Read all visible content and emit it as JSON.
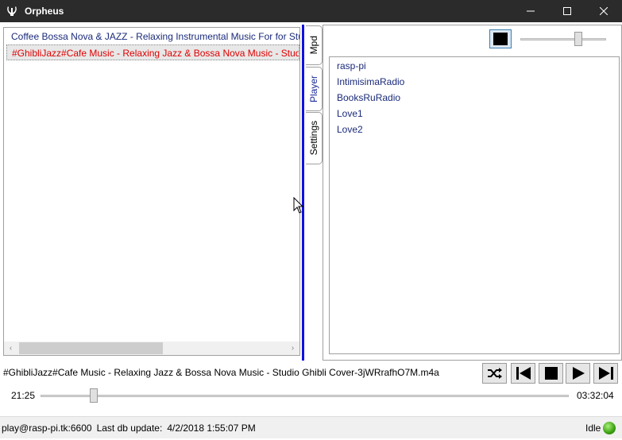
{
  "window": {
    "title": "Orpheus",
    "controls": [
      "minimize",
      "maximize",
      "close"
    ]
  },
  "playlist": {
    "items": [
      {
        "label": "Coffee Bossa Nova & JAZZ - Relaxing Instrumental Music For for Study"
      },
      {
        "label": "#GhibliJazz#Cafe Music - Relaxing Jazz & Bossa Nova Music - Studio Ghibli Cover"
      }
    ],
    "scroll_left": "‹",
    "scroll_right": "›"
  },
  "tabs": [
    {
      "label": "Mpd"
    },
    {
      "label": "Player"
    },
    {
      "label": "Settings"
    }
  ],
  "player": {
    "volume_fraction": 0.68,
    "stations": [
      "rasp-pi",
      "IntimisimaRadio",
      "BooksRuRadio",
      "Love1",
      "Love2"
    ]
  },
  "now_playing": {
    "title": "#GhibliJazz#Cafe Music - Relaxing Jazz & Bossa Nova Music - Studio Ghibli Cover-3jWRrafhO7M.m4a",
    "elapsed": "21:25",
    "total": "03:32:04",
    "progress_fraction": 0.101
  },
  "controls": {
    "icons": [
      "shuffle-icon",
      "previous-icon",
      "stop-icon",
      "play-icon",
      "next-icon"
    ]
  },
  "status": {
    "host": "play@rasp-pi.tk:6600",
    "db_label": "Last db update:",
    "db_value": "4/2/2018 1:55:07 PM",
    "state": "Idle",
    "state_color": "#3aa010"
  },
  "colors": {
    "selected_item": "#e00000",
    "list_text": "#1a2a7a",
    "splitter": "#1010e0"
  }
}
